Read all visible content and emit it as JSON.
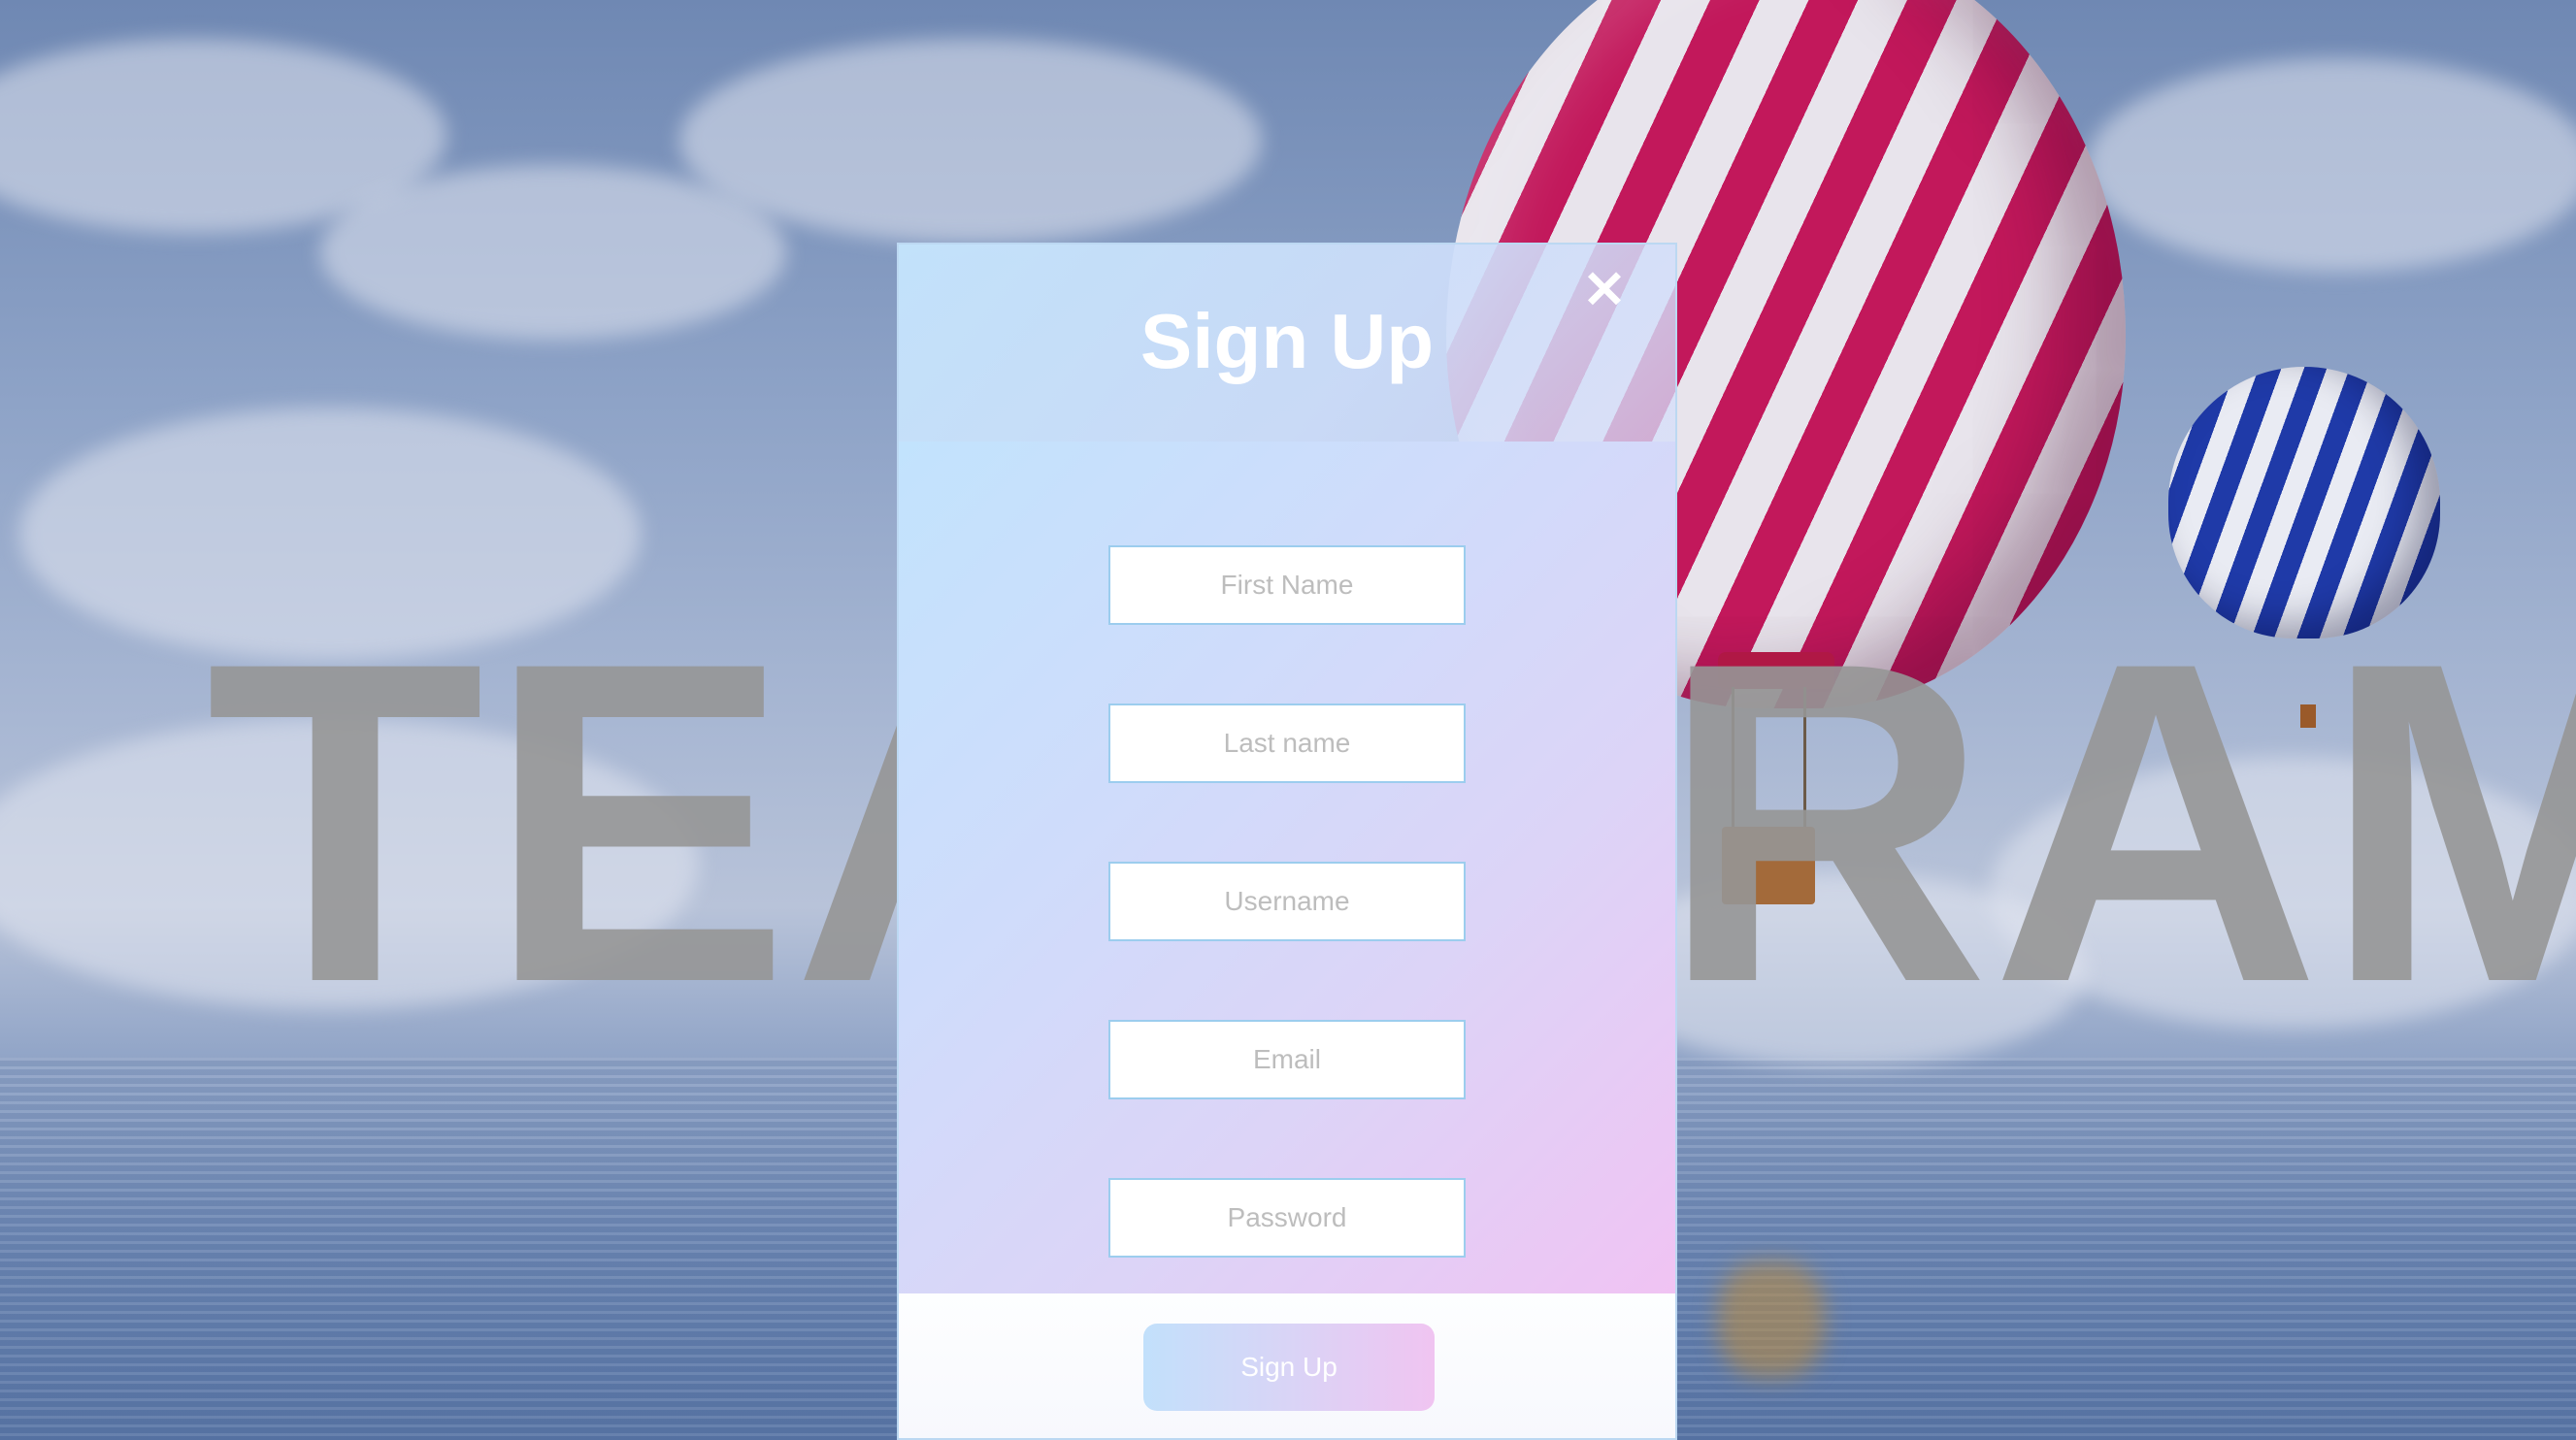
{
  "background": {
    "watermark_left": "TEA",
    "watermark_right": "RAM"
  },
  "modal": {
    "title": "Sign Up",
    "close_icon": "close-icon",
    "close_glyph": "✕",
    "fields": {
      "first_name": {
        "placeholder": "First Name",
        "value": ""
      },
      "last_name": {
        "placeholder": "Last name",
        "value": ""
      },
      "username": {
        "placeholder": "Username",
        "value": ""
      },
      "email": {
        "placeholder": "Email",
        "value": ""
      },
      "password": {
        "placeholder": "Password",
        "value": ""
      }
    },
    "submit_label": "Sign Up"
  },
  "colors": {
    "field_border": "#9ccdee",
    "button_gradient_start": "#c2e0fb",
    "button_gradient_end": "#f0c4f1",
    "title": "#ffffff"
  }
}
